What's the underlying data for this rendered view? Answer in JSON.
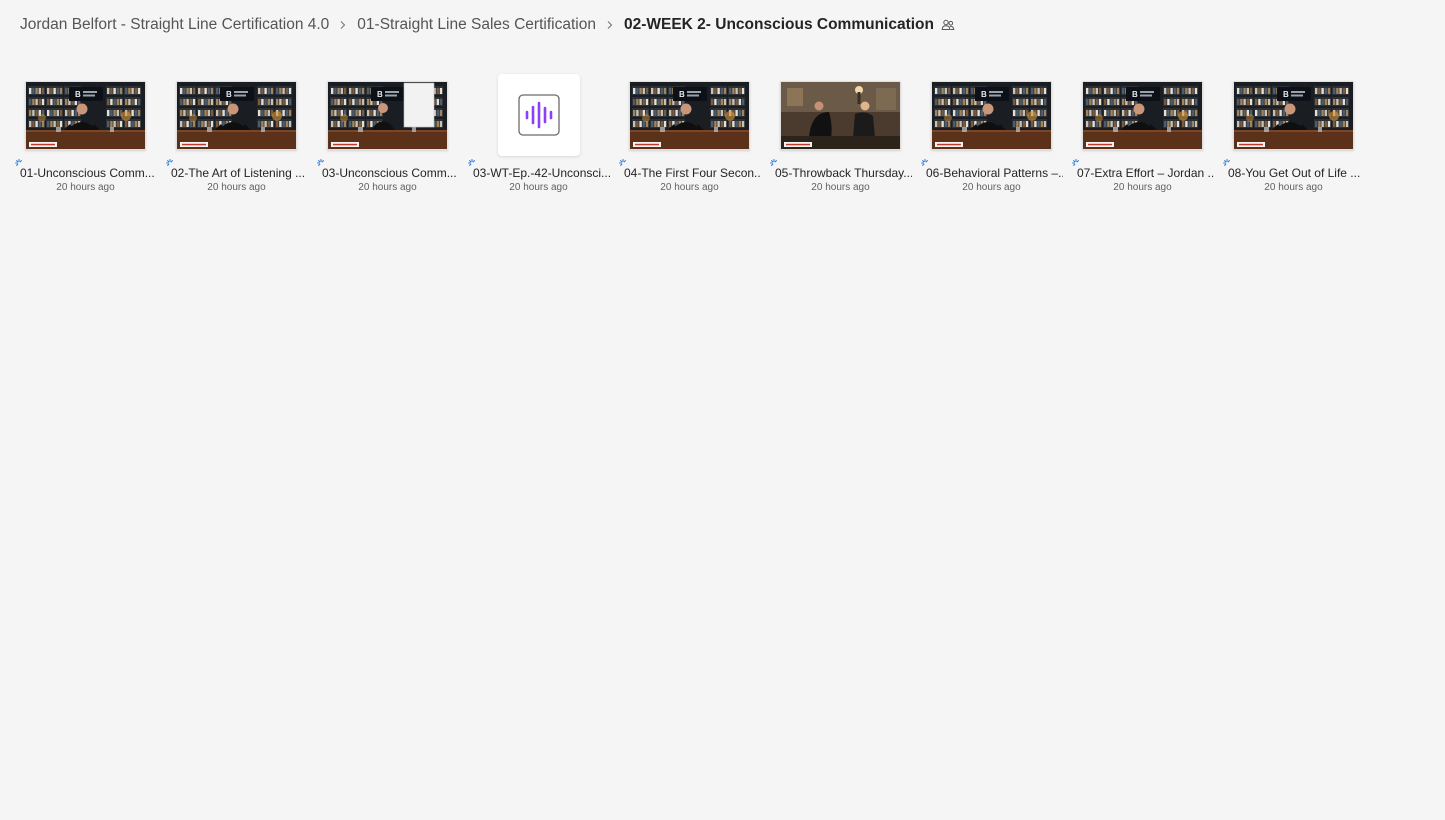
{
  "breadcrumb": {
    "items": [
      "Jordan Belfort - Straight Line Certification 4.0",
      "01-Straight Line Sales Certification"
    ],
    "current": "02-WEEK 2- Unconscious Communication"
  },
  "colors": {
    "accent": "#8a3ffc",
    "sync": "#2f7fd8",
    "background": "#f5f5f5"
  },
  "files": [
    {
      "name": "01-Unconscious Comm...",
      "modified": "20 hours ago",
      "kind": "video",
      "scene": "studio"
    },
    {
      "name": "02-The Art of Listening ...",
      "modified": "20 hours ago",
      "kind": "video",
      "scene": "studio"
    },
    {
      "name": "03-Unconscious Comm...",
      "modified": "20 hours ago",
      "kind": "video",
      "scene": "whiteboard"
    },
    {
      "name": "03-WT-Ep.-42-Unconsci...",
      "modified": "20 hours ago",
      "kind": "audio",
      "icon": "audio-waveform-icon"
    },
    {
      "name": "04-The First Four Secon...",
      "modified": "20 hours ago",
      "kind": "video",
      "scene": "studio"
    },
    {
      "name": "05-Throwback Thursday...",
      "modified": "20 hours ago",
      "kind": "video",
      "scene": "interview"
    },
    {
      "name": "06-Behavioral Patterns –...",
      "modified": "20 hours ago",
      "kind": "video",
      "scene": "studio"
    },
    {
      "name": "07-Extra Effort – Jordan ...",
      "modified": "20 hours ago",
      "kind": "video",
      "scene": "studio"
    },
    {
      "name": "08-You Get Out of Life ...",
      "modified": "20 hours ago",
      "kind": "video",
      "scene": "studio"
    }
  ]
}
